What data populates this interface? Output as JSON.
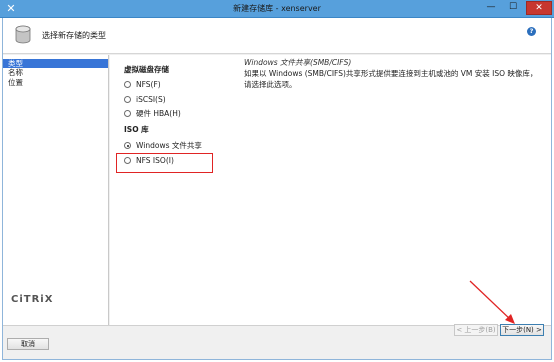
{
  "window": {
    "title": "新建存储库 - xenserver",
    "icon": "xenserver-x-icon",
    "minimize_glyph": "—",
    "maximize_glyph": "☐",
    "close_glyph": "✕"
  },
  "header": {
    "title": "选择新存储的类型",
    "help_glyph": "?"
  },
  "nav": {
    "items": [
      {
        "label": "类型",
        "active": true
      },
      {
        "label": "名称",
        "active": false
      },
      {
        "label": "位置",
        "active": false
      }
    ],
    "logo": "CiTRiX"
  },
  "content": {
    "virtual_disk_group": "虚拟磁盘存储",
    "iso_group": "ISO 库",
    "options": [
      {
        "label": "NFS(F)",
        "checked": false
      },
      {
        "label": "iSCSI(S)",
        "checked": false
      },
      {
        "label": "硬件 HBA(H)",
        "checked": false
      },
      {
        "label": "Windows 文件共享",
        "checked": true
      },
      {
        "label": "NFS ISO(I)",
        "checked": false
      }
    ],
    "description_title": "Windows 文件共享(SMB/CIFS)",
    "description_text": "如果以 Windows (SMB/CIFS)共享形式提供要连接到主机或池的 VM 安装 ISO 映像库，请选择此选项。"
  },
  "footer": {
    "prev_label": "< 上一步(B)",
    "next_label": "下一步(N) >",
    "cancel_label": "取消"
  },
  "colors": {
    "titlebar": "#57a0dc",
    "selection": "#3875d7",
    "annotation": "#e02424"
  }
}
